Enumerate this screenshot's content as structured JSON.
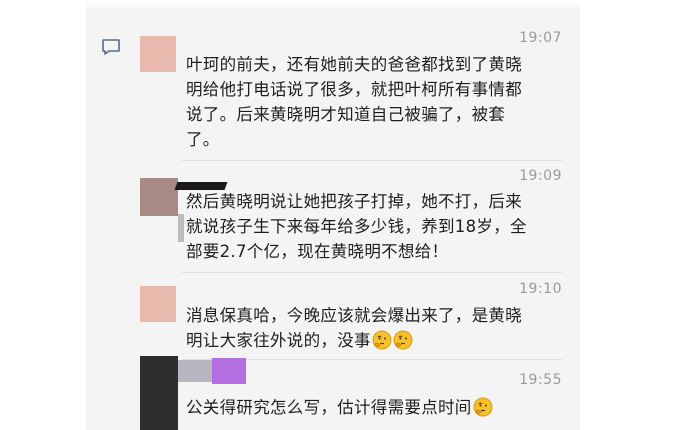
{
  "colors": {
    "panel_bg": "#f4f4f4",
    "divider": "#dedede",
    "timestamp": "#9a9a9a",
    "text": "#1e1e1e",
    "avatar_pink": "#e8b9ad",
    "avatar_brown": "#a78a84",
    "avatar_dark": "#2e2e2e",
    "avatar_purple": "#b36ee0"
  },
  "icons": {
    "feedback": "message-square-icon",
    "emoji": "thinking-face-icon"
  },
  "messages": [
    {
      "time": "19:07",
      "lines": [
        "叶珂的前夫，还有她前夫的爸爸都找到了黄晓",
        "明给他打电话说了很多，就把叶柯所有事情都",
        "说了。后来黄晓明才知道自己被骗了，被套",
        "了。"
      ]
    },
    {
      "time": "19:09",
      "lines": [
        "然后黄晓明说让她把孩子打掉，她不打，后来",
        "就说孩子生下来每年给多少钱，养到18岁，全",
        "部要2.7个亿，现在黄晓明不想给！"
      ]
    },
    {
      "time": "19:10",
      "lines": [
        "消息保真哈，今晚应该就会爆出来了，是黄晓",
        "明让大家往外说的，没事"
      ]
    },
    {
      "time": "19:55",
      "lines": [
        "公关得研究怎么写，估计得需要点时间"
      ]
    }
  ]
}
